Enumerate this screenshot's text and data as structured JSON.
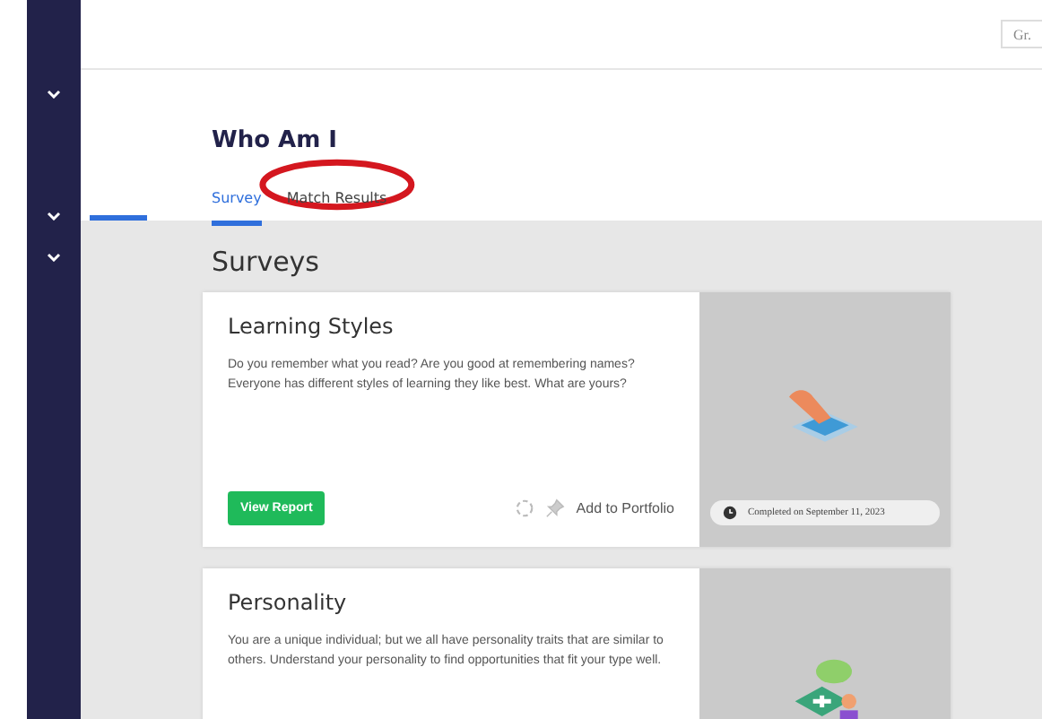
{
  "grade_button": "Gr.",
  "page_title": "Who Am I",
  "tabs": [
    {
      "label": "Survey",
      "selected": true,
      "circled": false
    },
    {
      "label": "Match Results",
      "selected": false,
      "circled": true
    }
  ],
  "section_title": "Surveys",
  "surveys": [
    {
      "title": "Learning Styles",
      "description": "Do you remember what you read? Are you good at remembering names? Everyone has different styles of learning they like best. What are yours?",
      "button": "View Report",
      "portfolio": "Add to Portfolio",
      "status": "Completed on September 11, 2023",
      "kind": "tablet"
    },
    {
      "title": "Personality",
      "description": "You are a unique individual; but we all have personality traits that are similar to others. Understand your personality to find opportunities that fit your type well.",
      "kind": "people"
    }
  ]
}
